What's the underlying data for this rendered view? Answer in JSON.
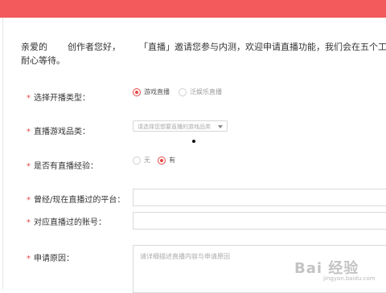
{
  "intro": {
    "greeting": "亲爱的",
    "creator": "创作者您好，",
    "body": "「直播」邀请您参与内测，欢迎申请直播功能，我们会在五个工作",
    "tail": "耐心等待。"
  },
  "form": {
    "type": {
      "label": "选择开播类型：",
      "options": [
        "游戏直播",
        "泛娱乐直播"
      ],
      "selected": "游戏直播"
    },
    "game": {
      "label": "直播游戏品类：",
      "placeholder": "请选择您想要直播的游戏品类"
    },
    "experience": {
      "label": "是否有直播经验：",
      "options": [
        "无",
        "有"
      ],
      "selected": "有"
    },
    "platform": {
      "label": "曾经/现在直播过的平台：",
      "value": ""
    },
    "account": {
      "label": "对应直播过的账号：",
      "value": ""
    },
    "reason": {
      "label": "申请原因：",
      "placeholder": "请详细描述直播内容与申请原因"
    },
    "required_mark": "*"
  },
  "watermark": {
    "main": "Bai 经验",
    "sub": "jingyan.baidu.com"
  },
  "colors": {
    "topbar": "#f25a5c",
    "accent": "#e64545"
  }
}
